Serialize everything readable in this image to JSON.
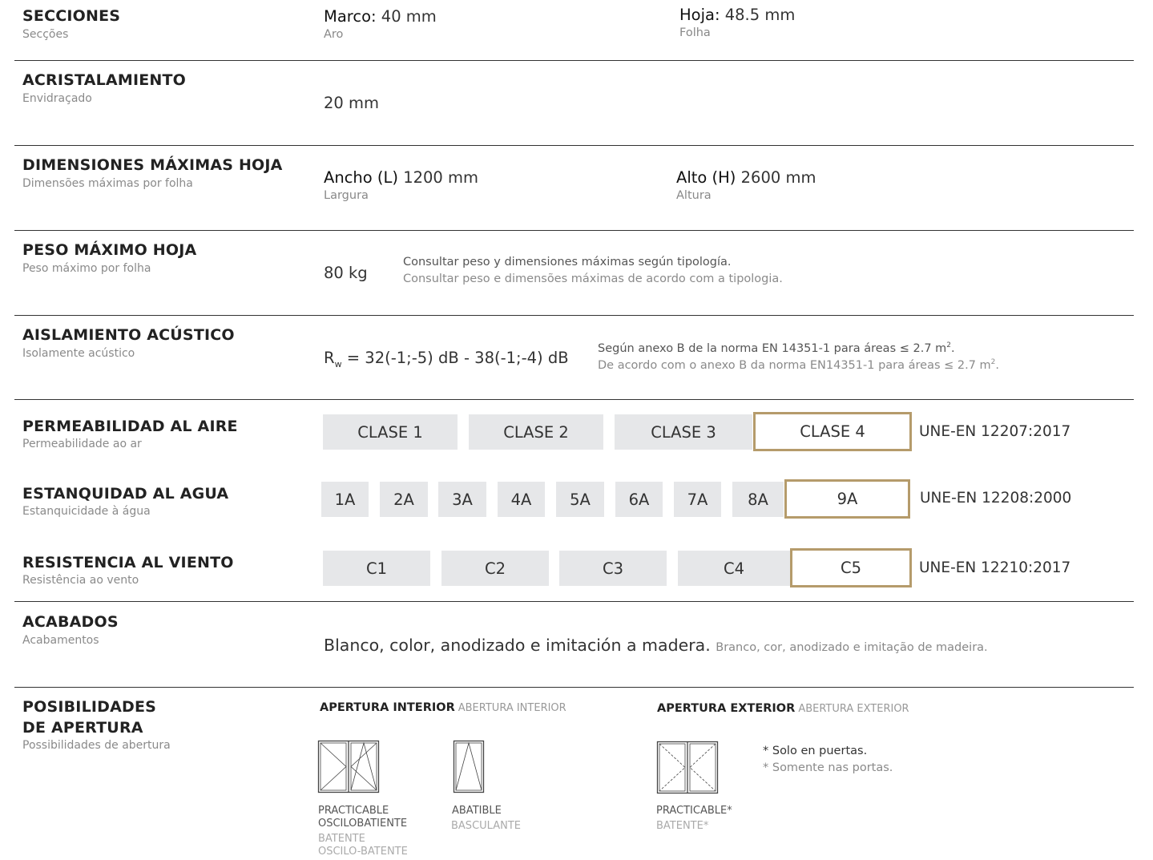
{
  "secciones": {
    "title": "SECCIONES",
    "subtitle": "Secções",
    "marco_label": "Marco:",
    "marco_value": "40 mm",
    "marco_sub": "Aro",
    "hoja_label": "Hoja:",
    "hoja_value": "48.5 mm",
    "hoja_sub": "Folha"
  },
  "acristalamiento": {
    "title": "ACRISTALAMIENTO",
    "subtitle": "Envidraçado",
    "value": "20 mm"
  },
  "dimensiones": {
    "title": "DIMENSIONES MÁXIMAS HOJA",
    "subtitle": "Dimensões máximas por folha",
    "ancho_label": "Ancho (L)",
    "ancho_value": "1200 mm",
    "ancho_sub": "Largura",
    "alto_label": "Alto (H)",
    "alto_value": "2600 mm",
    "alto_sub": "Altura"
  },
  "peso": {
    "title": "PESO MÁXIMO HOJA",
    "subtitle": "Peso máximo por folha",
    "value": "80 kg",
    "note_es": "Consultar peso y dimensiones máximas según tipología.",
    "note_pt": "Consultar peso e dimensões máximas de acordo com a tipologia."
  },
  "aislamiento": {
    "title": "AISLAMIENTO ACÚSTICO",
    "subtitle": "Isolamente acústico",
    "r": "R",
    "r_sub": "w",
    "value": "= 32(-1;-5) dB - 38(-1;-4) dB",
    "note_es": "Según anexo B de la norma EN 14351-1 para áreas ≤ 2.7 m",
    "note_pt": "De acordo com o anexo B da norma EN14351-1 para áreas ≤ 2.7 m",
    "note_sup": "2",
    "note_end": "."
  },
  "permeabilidad": {
    "title": "PERMEABILIDAD AL AIRE",
    "subtitle": "Permeabilidade ao ar",
    "classes": [
      "CLASE 1",
      "CLASE 2",
      "CLASE 3",
      "CLASE 4"
    ],
    "selected": "CLASE 4",
    "standard": "UNE-EN 12207:2017"
  },
  "estanquidad": {
    "title": "ESTANQUIDAD AL AGUA",
    "subtitle": "Estanquicidade à água",
    "classes": [
      "1A",
      "2A",
      "3A",
      "4A",
      "5A",
      "6A",
      "7A",
      "8A",
      "9A"
    ],
    "selected": "9A",
    "standard": "UNE-EN 12208:2000"
  },
  "resistencia": {
    "title": "RESISTENCIA AL VIENTO",
    "subtitle": "Resistência ao vento",
    "classes": [
      "C1",
      "C2",
      "C3",
      "C4",
      "C5"
    ],
    "selected": "C5",
    "standard": "UNE-EN 12210:2017"
  },
  "acabados": {
    "title": "ACABADOS",
    "subtitle": "Acabamentos",
    "value": "Blanco, color, anodizado e imitación a madera.",
    "value_pt": "Branco, cor, anodizado e imitação de madeira."
  },
  "apertura": {
    "title_line1": "POSIBILIDADES",
    "title_line2": "DE APERTURA",
    "subtitle": "Possibilidades de abertura",
    "interior_label": "APERTURA INTERIOR",
    "interior_label_pt": "ABERTURA INTERIOR",
    "exterior_label": "APERTURA EXTERIOR",
    "exterior_label_pt": "ABERTURA EXTERIOR",
    "icon1_es_1": "PRACTICABLE",
    "icon1_es_2": "OSCILOBATIENTE",
    "icon1_pt_1": "BATENTE",
    "icon1_pt_2": "OSCILO-BATENTE",
    "icon2_es": "ABATIBLE",
    "icon2_pt": "BASCULANTE",
    "icon3_es": "PRACTICABLE*",
    "icon3_pt": "BATENTE*",
    "footnote_es": "* Solo en puertas.",
    "footnote_pt": "* Somente nas portas."
  },
  "colors": {
    "accent": "#b59b6b",
    "box": "#e6e7e9"
  }
}
